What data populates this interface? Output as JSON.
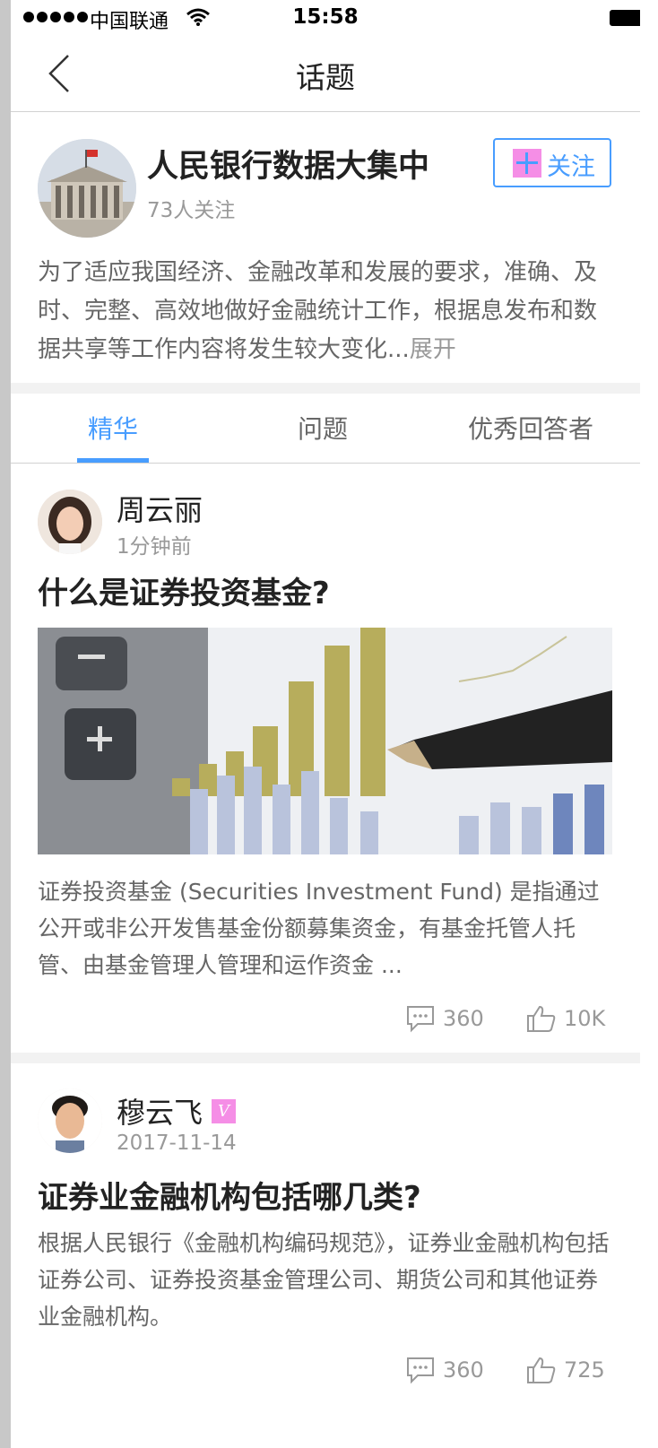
{
  "status_bar": {
    "carrier": "中国联通",
    "time": "15:58"
  },
  "nav": {
    "title": "话题"
  },
  "topic": {
    "title": "人民银行数据大集中",
    "followers": "73人关注",
    "follow_label": "关注",
    "description": "为了适应我国经济、金融改革和发展的要求，准确、及时、完整、高效地做好金融统计工作，根据息发布和数据共享等工作内容将发生较大变化...",
    "expand_label": "展开"
  },
  "tabs": [
    {
      "label": "精华",
      "active": true
    },
    {
      "label": "问题",
      "active": false
    },
    {
      "label": "优秀回答者",
      "active": false
    }
  ],
  "posts": [
    {
      "author": "周云丽",
      "time": "1分钟前",
      "title": "什么是证券投资基金?",
      "body": "证券投资基金 (Securities Investment Fund) 是指通过公开或非公开发售基金份额募集资金，有基金托管人托管、由基金管理人管理和运作资金 ...",
      "comments": "360",
      "likes": "10K"
    },
    {
      "author": "穆云飞",
      "badge": "V",
      "time": "2017-11-14",
      "title": "证券业金融机构包括哪几类?",
      "body": "根据人民银行《金融机构编码规范》，证券业金融机构包括证券公司、证券投资基金管理公司、期货公司和其他证券业金融机构。",
      "comments": "360",
      "likes": "725"
    }
  ],
  "colors": {
    "accent": "#489dff",
    "title": "#222222",
    "body": "#666666",
    "meta": "#999999",
    "divider": "#d2d2d2"
  }
}
